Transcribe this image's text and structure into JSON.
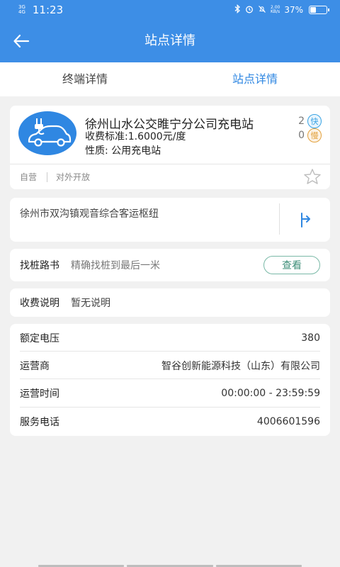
{
  "status_bar": {
    "net_top": "3G",
    "net_bottom": "4G",
    "time": "11:23",
    "speed_top": "2.00",
    "speed_bottom": "KB/s",
    "battery": "37%",
    "battery_level": 0.37
  },
  "header": {
    "title": "站点详情"
  },
  "tabs": [
    {
      "label": "终端详情",
      "active": false
    },
    {
      "label": "站点详情",
      "active": true
    }
  ],
  "station": {
    "name": "徐州山水公交睢宁分公司充电站",
    "fee": "收费标准:1.6000元/度",
    "nature": "性质: 公用充电站",
    "fast_count": "2",
    "fast_label": "快",
    "slow_count": "0",
    "slow_label": "慢",
    "tags": [
      "自营",
      "对外开放"
    ]
  },
  "address": {
    "text": "徐州市双沟镇观音综合客运枢纽"
  },
  "guide": {
    "label": "找桩路书",
    "desc": "精确找桩到最后一米",
    "button": "查看"
  },
  "fee_note": {
    "label": "收费说明",
    "value": "暂无说明"
  },
  "info": [
    {
      "label": "额定电压",
      "value": "380"
    },
    {
      "label": "运营商",
      "value": "智谷创新能源科技（山东）有限公司"
    },
    {
      "label": "运营时间",
      "value": "00:00:00 - 23:59:59"
    },
    {
      "label": "服务电话",
      "value": "4006601596"
    }
  ],
  "colors": {
    "primary": "#3d8ee6",
    "tab_active": "#2f87e2",
    "fast_badge": "#39a3e3",
    "slow_badge": "#e2a13d"
  }
}
